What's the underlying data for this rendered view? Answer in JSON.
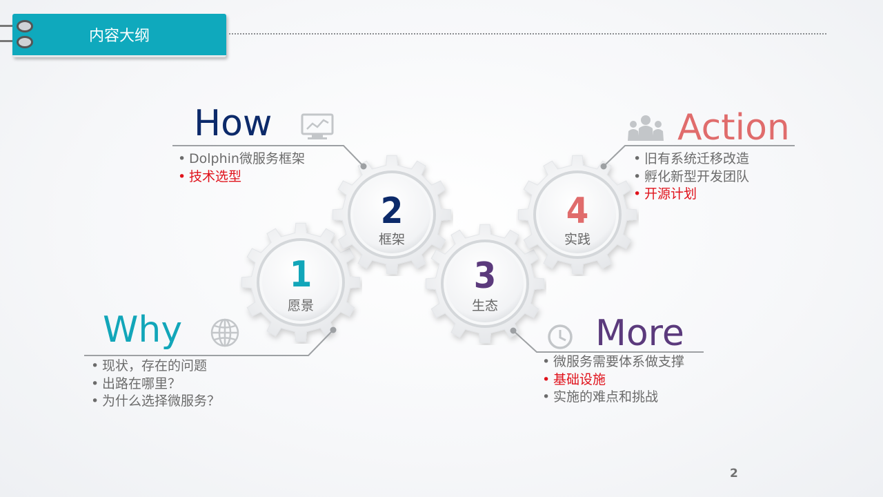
{
  "header": {
    "title": "内容大纲"
  },
  "gears": [
    {
      "number": "1",
      "label": "愿景",
      "color": "#12a6b9"
    },
    {
      "number": "2",
      "label": "框架",
      "color": "#0c2a6a"
    },
    {
      "number": "3",
      "label": "生态",
      "color": "#5b3a7c"
    },
    {
      "number": "4",
      "label": "实践",
      "color": "#e06c6c"
    }
  ],
  "sections": {
    "why": {
      "title": "Why",
      "color": "#12a6b9",
      "icon": "globe-icon",
      "items": [
        {
          "text": "现状，存在的问题",
          "highlight": false
        },
        {
          "text": "出路在哪里？",
          "highlight": false
        },
        {
          "text": "为什么选择微服务？",
          "highlight": false
        }
      ]
    },
    "how": {
      "title": "How",
      "color": "#0c2a6a",
      "icon": "monitor-chart-icon",
      "items": [
        {
          "text": "Dolphin微服务框架",
          "highlight": false
        },
        {
          "text": "技术选型",
          "highlight": true
        }
      ]
    },
    "more": {
      "title": "More",
      "color": "#5b3a7c",
      "icon": "clock-icon",
      "items": [
        {
          "text": "微服务需要体系做支撑",
          "highlight": false
        },
        {
          "text": "基础设施",
          "highlight": true
        },
        {
          "text": "实施的难点和挑战",
          "highlight": false
        }
      ]
    },
    "action": {
      "title": "Action",
      "color": "#e06c6c",
      "icon": "team-icon",
      "items": [
        {
          "text": "旧有系统迁移改造",
          "highlight": false
        },
        {
          "text": "孵化新型开发团队",
          "highlight": false
        },
        {
          "text": "开源计划",
          "highlight": true
        }
      ]
    }
  },
  "bullet_char": "•",
  "page_number": "2"
}
